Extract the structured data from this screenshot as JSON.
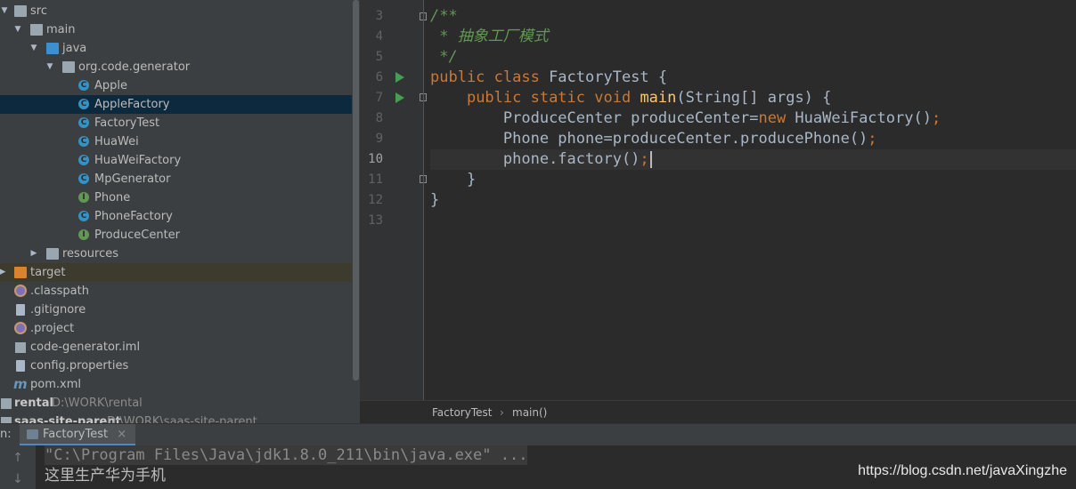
{
  "project_tree": {
    "rows": [
      {
        "label": "src",
        "extra": "",
        "icon": "folder-icon"
      },
      {
        "label": "main",
        "extra": "",
        "icon": "folder-icon"
      },
      {
        "label": "java",
        "extra": "",
        "icon": "source-folder-icon"
      },
      {
        "label": "org.code.generator",
        "extra": "",
        "icon": "package-icon"
      },
      {
        "label": "Apple",
        "extra": "",
        "icon": "class-icon"
      },
      {
        "label": "AppleFactory",
        "extra": "",
        "icon": "class-icon"
      },
      {
        "label": "FactoryTest",
        "extra": "",
        "icon": "class-icon"
      },
      {
        "label": "HuaWei",
        "extra": "",
        "icon": "class-icon"
      },
      {
        "label": "HuaWeiFactory",
        "extra": "",
        "icon": "class-icon"
      },
      {
        "label": "MpGenerator",
        "extra": "",
        "icon": "class-icon"
      },
      {
        "label": "Phone",
        "extra": "",
        "icon": "interface-icon"
      },
      {
        "label": "PhoneFactory",
        "extra": "",
        "icon": "class-icon"
      },
      {
        "label": "ProduceCenter",
        "extra": "",
        "icon": "interface-icon"
      },
      {
        "label": "resources",
        "extra": "",
        "icon": "resources-folder-icon"
      },
      {
        "label": "target",
        "extra": "",
        "icon": "excluded-folder-icon"
      },
      {
        "label": ".classpath",
        "extra": "",
        "icon": "eclipse-file-icon"
      },
      {
        "label": ".gitignore",
        "extra": "",
        "icon": "text-file-icon"
      },
      {
        "label": ".project",
        "extra": "",
        "icon": "eclipse-file-icon"
      },
      {
        "label": "code-generator.iml",
        "extra": "",
        "icon": "module-file-icon"
      },
      {
        "label": "config.properties",
        "extra": "",
        "icon": "properties-file-icon"
      },
      {
        "label": "pom.xml",
        "extra": "",
        "icon": "maven-icon"
      },
      {
        "label": "rental",
        "extra": "D:\\WORK\\rental",
        "icon": "module-icon"
      },
      {
        "label": "saas-site-parent",
        "extra": "D:\\WORK\\saas-site-parent",
        "icon": "module-icon"
      }
    ],
    "selected_index": 5
  },
  "editor": {
    "line_numbers": [
      "3",
      "4",
      "5",
      "6",
      "7",
      "8",
      "9",
      "10",
      "11",
      "12",
      "13"
    ],
    "current_line": "10",
    "code": {
      "l3": "/**",
      "l4": " * 抽象工厂模式",
      "l5": " */",
      "l6_kw": "public class",
      "l6_rest": " FactoryTest {",
      "l7_kw": "public static void",
      "l7_fn": "main",
      "l7_rest": "(String[] args) {",
      "l8_a": "ProduceCenter produceCenter=",
      "l8_kw": "new",
      "l8_b": " HuaWeiFactory()",
      "l8_semi": ";",
      "l9_a": "Phone phone=produceCenter.producePhone()",
      "l9_semi": ";",
      "l10_a": "phone.factory()",
      "l10_semi": ";",
      "l11": "}",
      "l12": "}"
    },
    "breadcrumbs": [
      "FactoryTest",
      "main()"
    ],
    "breadcrumb_separator": "›"
  },
  "run_panel": {
    "prefix": "n:",
    "tab_label": "FactoryTest",
    "close_glyph": "×",
    "toolbar": {
      "up_glyph": "↑",
      "down_glyph": "↓"
    },
    "console": [
      "\"C:\\Program Files\\Java\\jdk1.8.0_211\\bin\\java.exe\" ...",
      "这里生产华为手机"
    ]
  },
  "watermark": "https://blog.csdn.net/javaXingzhe",
  "colors": {
    "background": "#2b2b2b",
    "tree_background": "#3c3f41",
    "selection": "#0d293e",
    "keyword": "#cc7832",
    "function": "#ffc66d",
    "comment": "#629755",
    "run_icon": "#499c54"
  }
}
